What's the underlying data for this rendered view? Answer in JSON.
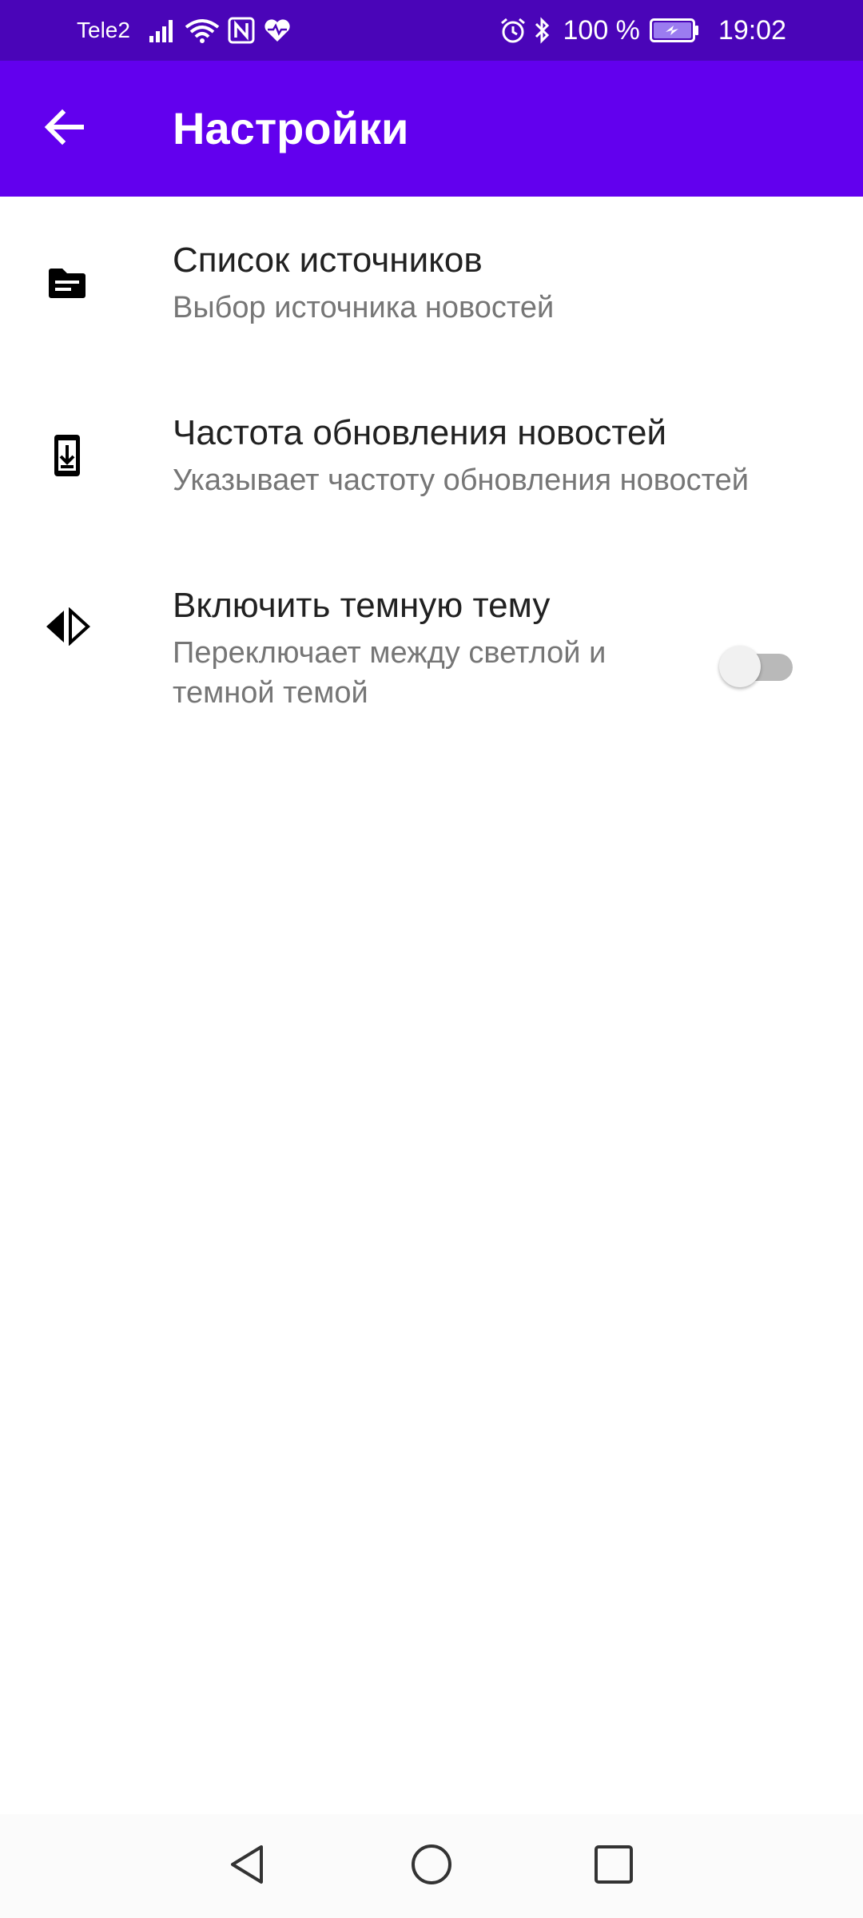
{
  "status_bar": {
    "carrier": "Tele2",
    "battery": "100 %",
    "time": "19:02",
    "icons": [
      "signal-icon",
      "wifi-icon",
      "nfc-icon",
      "health-icon",
      "alarm-icon",
      "bluetooth-icon",
      "battery-charging-icon"
    ]
  },
  "app_bar": {
    "title": "Настройки",
    "back_icon": "arrow-back-icon"
  },
  "settings": {
    "items": [
      {
        "title": "Список источников",
        "summary": "Выбор источника новостей",
        "icon": "source-folder-icon"
      },
      {
        "title": "Частота обновления новостей",
        "summary": "Указывает частоту обновления новостей",
        "icon": "phone-download-icon"
      },
      {
        "title": "Включить темную тему",
        "summary": "Переключает между светлой и темной темой",
        "icon": "theme-compare-icon",
        "switch_on": false
      }
    ]
  },
  "nav_bar": {
    "icons": [
      "nav-back-icon",
      "nav-home-icon",
      "nav-recents-icon"
    ]
  },
  "colors": {
    "status_bar": "#4a05b8",
    "app_bar": "#6200ee",
    "title_text": "#212121",
    "summary_text": "#767676",
    "switch_track_off": "#b9b9b9",
    "switch_thumb_off": "#f1f1f1"
  }
}
